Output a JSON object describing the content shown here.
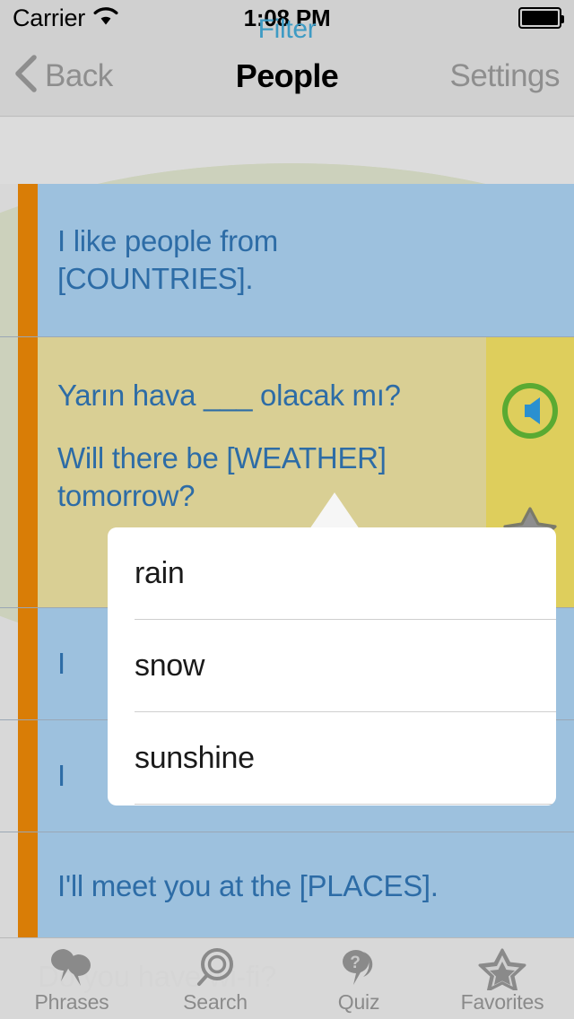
{
  "status_bar": {
    "carrier": "Carrier",
    "wifi_icon": "wifi-icon",
    "time": "1:08 PM",
    "battery_icon": "battery-full-icon"
  },
  "nav_bar": {
    "back_label": "Back",
    "back_icon": "chevron-left-icon",
    "title": "People",
    "settings_label": "Settings"
  },
  "filter_bar": {
    "label": "Filter"
  },
  "list": {
    "rows": [
      {
        "id": "row-countries",
        "style": "blue",
        "lines": [
          "I like people from",
          "[COUNTRIES]."
        ],
        "active": false
      },
      {
        "id": "row-weather",
        "style": "yellow",
        "active": true,
        "source_text": "Yarın hava ___ olacak mı?",
        "translation_line1": "Will there be [WEATHER]",
        "translation_line2": "tomorrow?",
        "speaker_icon": "speaker-icon",
        "favorite_icon": "star-icon"
      },
      {
        "id": "row-hidden-1",
        "style": "blue",
        "lines": [
          "I"
        ],
        "active": false
      },
      {
        "id": "row-hidden-2",
        "style": "blue",
        "lines": [
          "I"
        ],
        "active": false
      },
      {
        "id": "row-places",
        "style": "blue",
        "lines": [
          "I'll meet you at the [PLACES]."
        ],
        "active": false
      }
    ]
  },
  "popover": {
    "options": [
      "rain",
      "snow",
      "sunshine"
    ]
  },
  "bleed_text": "Do you have wi-fi?",
  "tab_bar": {
    "items": [
      {
        "label": "Phrases",
        "icon": "speech-bubbles-icon"
      },
      {
        "label": "Search",
        "icon": "magnifier-icon"
      },
      {
        "label": "Quiz",
        "icon": "question-bubble-icon"
      },
      {
        "label": "Favorites",
        "icon": "star-outline-icon"
      }
    ]
  },
  "colors": {
    "stripe_orange": "#d97d06",
    "row_blue": "#9dc1de",
    "row_yellow": "#d9cf94",
    "icon_panel_yellow": "#dece5c",
    "row_text_blue": "#2d6ca6",
    "filter_blue": "#3e9bc4",
    "sage": "#ccd1bc",
    "speaker_ring_green": "#5aaa32",
    "speaker_blue": "#2a90d0",
    "star_gray": "#8e8e8e"
  }
}
